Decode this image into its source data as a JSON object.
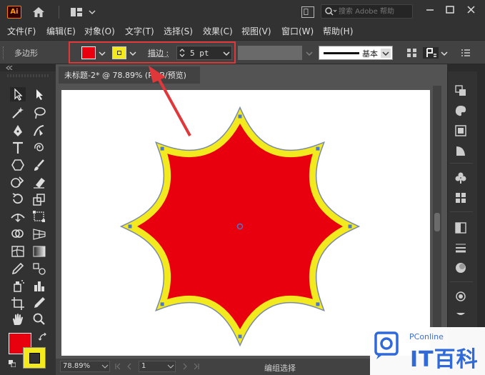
{
  "app": {
    "logo_text": "Ai",
    "search_placeholder": "搜索 Adobe 帮助"
  },
  "menu": {
    "items": [
      "文件(F)",
      "编辑(E)",
      "对象(O)",
      "文字(T)",
      "选择(S)",
      "效果(C)",
      "视图(V)",
      "窗口(W)",
      "帮助(H)"
    ]
  },
  "control_bar": {
    "tool_name": "多边形",
    "fill_color": "#e8000e",
    "stroke_color": "#f2ea1f",
    "stroke_label": "描边 :",
    "stroke_weight": "5 pt",
    "profile_label": "基本"
  },
  "document": {
    "tab_title": "未标题-2* @ 78.89% (RGB/预览)",
    "zoom": "78.89%",
    "artboard": "1",
    "status": "编组选择"
  },
  "shape": {
    "type": "octagram-star",
    "fill": "#e8000e",
    "stroke": "#f2ea1f",
    "stroke_weight": "5 pt"
  },
  "watermark": {
    "top_text": "PConline",
    "big_text": "IT百科"
  },
  "icons": {
    "home": "home-icon",
    "search": "search-icon",
    "minimize": "minimize-icon",
    "maximize": "maximize-icon",
    "close": "close-icon"
  }
}
